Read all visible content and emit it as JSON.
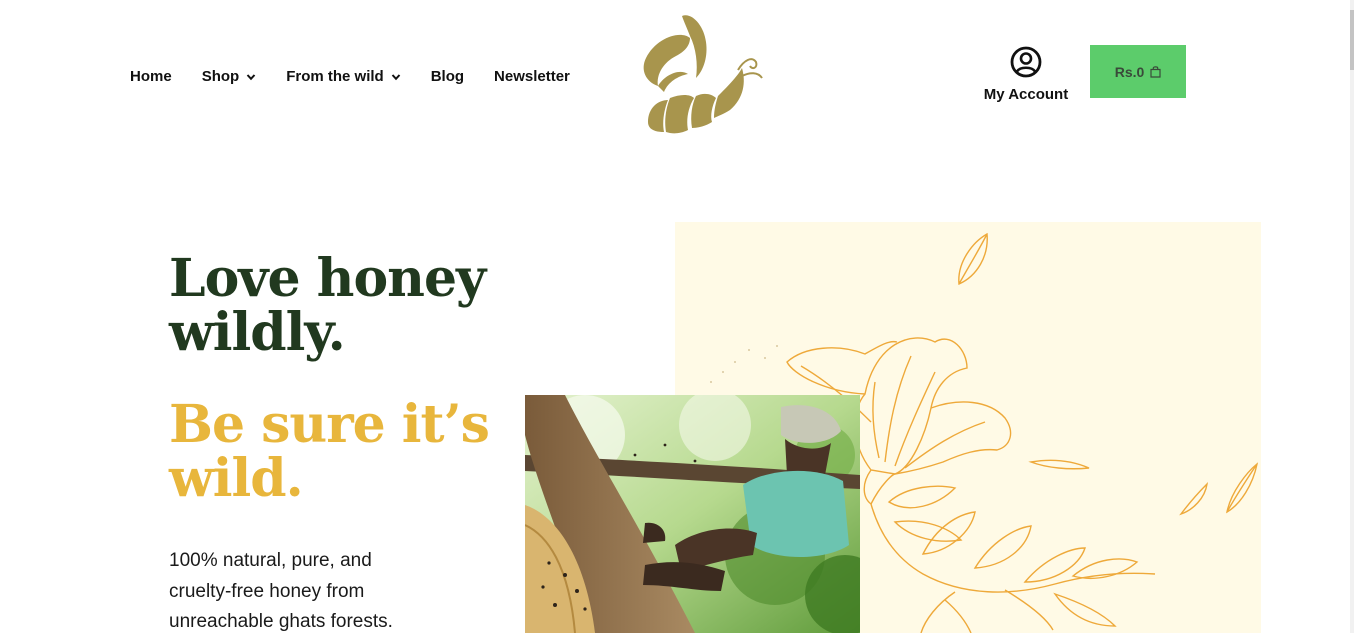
{
  "nav": {
    "home": "Home",
    "shop": "Shop",
    "wild": "From the wild",
    "blog": "Blog",
    "newsletter": "Newsletter"
  },
  "account": {
    "label": "My Account"
  },
  "cart": {
    "amount": "Rs.0"
  },
  "hero": {
    "line1": "Love honey",
    "line2": "wildly.",
    "line3": "Be sure it’s",
    "line4": "wild.",
    "desc1": "100% natural, pure, and",
    "desc2": "cruelty-free honey from",
    "desc3": "unreachable ghats forests."
  },
  "colors": {
    "brand_olive": "#a8954d",
    "heading_green": "#21391f",
    "accent_yellow": "#e8b63c",
    "cart_green": "#5ccc6b",
    "panel_cream": "#fffae6",
    "illustration_orange": "#eea93a"
  },
  "icons": {
    "logo": "bee-logo-icon",
    "account": "user-circle-icon",
    "cart": "shopping-bag-icon",
    "dropdown": "chevron-down-icon"
  }
}
